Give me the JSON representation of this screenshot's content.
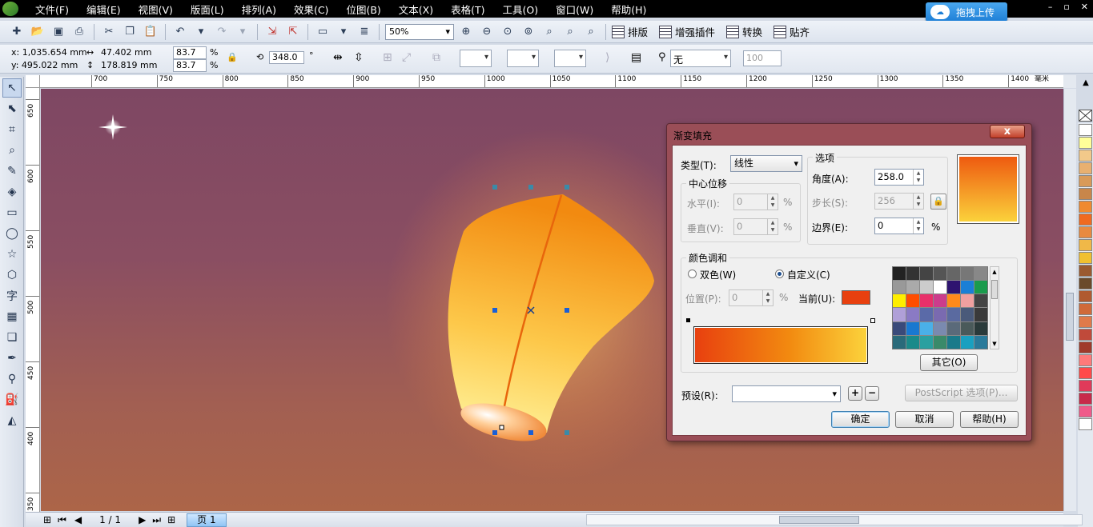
{
  "menu": {
    "items": [
      "文件(F)",
      "编辑(E)",
      "视图(V)",
      "版面(L)",
      "排列(A)",
      "效果(C)",
      "位图(B)",
      "文本(X)",
      "表格(T)",
      "工具(O)",
      "窗口(W)",
      "帮助(H)"
    ],
    "upload_label": "拖拽上传",
    "window_controls": [
      "–",
      "▫",
      "✕"
    ]
  },
  "toolbar": {
    "zoom": "50%",
    "paiban": "排版",
    "plugin": "增强插件",
    "convert": "转换",
    "paste": "贴齐"
  },
  "propbar": {
    "x": "x: 1,035.654 mm",
    "y": "y: 495.022 mm",
    "w": "47.402 mm",
    "h": "178.819 mm",
    "sx": "83.7",
    "sy": "83.7",
    "pct": "%",
    "rotation": "348.0",
    "deg": "°",
    "outline": "无",
    "misc": "100"
  },
  "ruler": {
    "h_labels": [
      "700",
      "750",
      "800",
      "850",
      "900",
      "950",
      "1000",
      "1050",
      "1100",
      "1150",
      "1200",
      "1250",
      "1300",
      "1350",
      "1400",
      "毫米"
    ],
    "v_labels": [
      "650",
      "600",
      "550",
      "500",
      "450",
      "400",
      "350"
    ]
  },
  "status": {
    "page_count": "1 / 1",
    "page_tab": "页 1"
  },
  "dialog": {
    "title": "渐变填充",
    "close": "x",
    "type_label": "类型(T):",
    "type_value": "线性",
    "center_group": "中心位移",
    "horizontal_label": "水平(I):",
    "horizontal_value": "0",
    "vertical_label": "垂直(V):",
    "vertical_value": "0",
    "options_group": "选项",
    "angle_label": "角度(A):",
    "angle_value": "258.0",
    "steps_label": "步长(S):",
    "steps_value": "256",
    "edge_label": "边界(E):",
    "edge_value": "0",
    "pct": "%",
    "blend_group": "颜色调和",
    "two_color": "双色(W)",
    "custom": "自定义(C)",
    "position_label": "位置(P):",
    "position_value": "0",
    "current_label": "当前(U):",
    "current_color": "#e8400f",
    "other_button": "其它(O)",
    "preset_label": "预设(R):",
    "postscript_button": "PostScript 选项(P)...",
    "ok": "确定",
    "cancel": "取消",
    "help": "帮助(H)",
    "palette": [
      "#222222",
      "#333333",
      "#444444",
      "#555555",
      "#666666",
      "#777777",
      "#888888",
      "#999999",
      "#aaaaaa",
      "#cccccc",
      "#ffffff",
      "#2e1470",
      "#1a7fd6",
      "#1a9b4c",
      "#ffee00",
      "#ff4d00",
      "#e8306a",
      "#cc3c8c",
      "#ff8a1c",
      "#f0a0a0",
      "#444444",
      "#b0a0d8",
      "#8a7ac4",
      "#5a6aa8",
      "#7a6ab0",
      "#5a6aa0",
      "#4a5a7a",
      "#3a3a3a",
      "#3a4a7a",
      "#1a78d0",
      "#4ab0e8",
      "#7a8ab0",
      "#5a6a7a",
      "#4a5a5a",
      "#2a3a3a",
      "#2a6a7a",
      "#1a8a8a",
      "#2aa0a0",
      "#3a8a6a",
      "#1a7a8a",
      "#1aa0c0",
      "#2a7a9a"
    ]
  },
  "colors": {
    "grad_start": "#e8400f",
    "grad_end": "#fbd23b",
    "preview_start": "#ee5a10",
    "preview_end": "#fbd23b"
  },
  "right_palette": [
    "#ffffff",
    "#ffff99",
    "#f2c98a",
    "#e8b070",
    "#d99a58",
    "#c8864a",
    "#f08a30",
    "#f06a20",
    "#e88a40",
    "#f0b848",
    "#f0c030",
    "#9a5a30",
    "#6a4a2a",
    "#b05a30",
    "#d06a3a",
    "#e07a4a",
    "#c04a3a",
    "#a03a2a",
    "#ff7a7a",
    "#ff4a4a",
    "#e03a5a",
    "#c82a4a",
    "#f05a8a",
    "#ffffff"
  ]
}
